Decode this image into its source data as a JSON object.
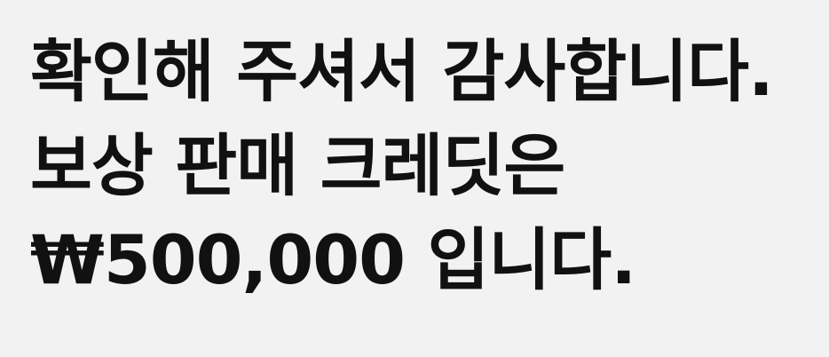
{
  "confirmation": {
    "line1": "확인해 주셔서 감사합니다.",
    "line2": "보상 판매 크레딧은",
    "line3": "₩500,000 입니다."
  },
  "colors": {
    "background": "#f2f2f2",
    "text": "#111111"
  }
}
